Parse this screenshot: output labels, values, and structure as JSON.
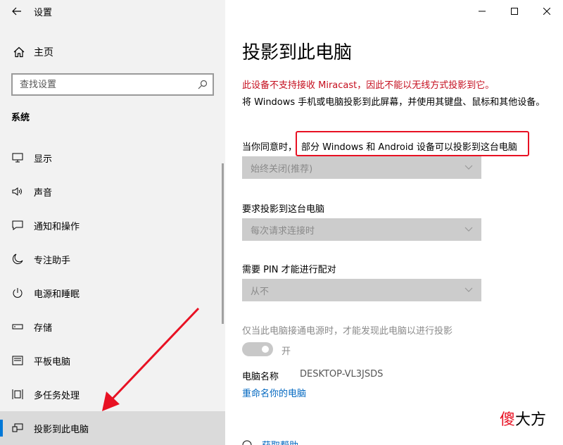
{
  "app": {
    "title": "设置"
  },
  "sidebar": {
    "home_label": "主页",
    "search_placeholder": "查找设置",
    "section_title": "系统",
    "items": [
      {
        "label": "显示",
        "icon": "monitor-icon"
      },
      {
        "label": "声音",
        "icon": "speaker-icon"
      },
      {
        "label": "通知和操作",
        "icon": "notification-icon"
      },
      {
        "label": "专注助手",
        "icon": "moon-icon"
      },
      {
        "label": "电源和睡眠",
        "icon": "power-icon"
      },
      {
        "label": "存储",
        "icon": "storage-icon"
      },
      {
        "label": "平板电脑",
        "icon": "tablet-icon"
      },
      {
        "label": "多任务处理",
        "icon": "multitask-icon"
      },
      {
        "label": "投影到此电脑",
        "icon": "project-icon",
        "active": true
      }
    ]
  },
  "main": {
    "title": "投影到此电脑",
    "warning": "此设备不支持接收 Miracast，因此不能以无线方式投影到它。",
    "description": "将 Windows 手机或电脑投影到此屏幕，并使用其键盘、鼠标和其他设备。",
    "allow_label_prefix": "当你同意时，",
    "allow_label_highlight": "部分 Windows 和 Android 设备可以投影到这台电脑",
    "allow_dropdown_value": "始终关闭(推荐)",
    "ask_label": "要求投影到这台电脑",
    "ask_dropdown_value": "每次请求连接时",
    "pin_label": "需要 PIN 才能进行配对",
    "pin_dropdown_value": "从不",
    "power_label": "仅当此电脑接通电源时，才能发现此电脑以进行投影",
    "toggle_label": "开",
    "toggle_on": true,
    "pc_name_label": "电脑名称",
    "pc_name_value": "DESKTOP-VL3JSDS",
    "rename_link": "重命名你的电脑",
    "help_link": "获取帮助"
  },
  "watermark": {
    "part1": "傻",
    "part2": "大方"
  },
  "colors": {
    "accent": "#0078d7",
    "warning": "#c50f1f",
    "highlight_border": "#e81123",
    "link": "#0067c0"
  }
}
